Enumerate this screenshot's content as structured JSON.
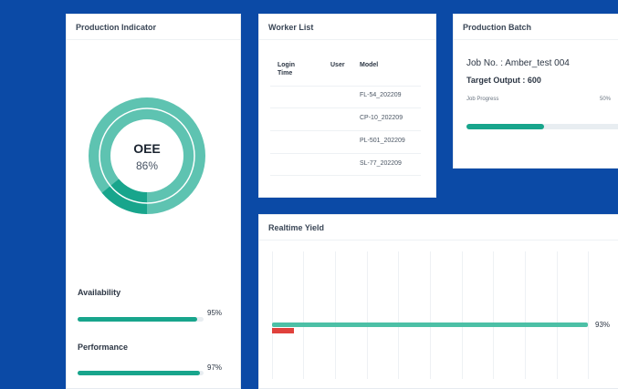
{
  "colors": {
    "background": "#0b4aa6",
    "accent": "#18a58c",
    "ring_light": "#5ec3b1",
    "alert": "#e0413c"
  },
  "indicator": {
    "title": "Production Indicator",
    "oee_label": "OEE",
    "oee_value": "86%",
    "oee_fraction": 0.86,
    "availability_label": "Availability",
    "availability_pct": "95%",
    "availability_fraction": 0.95,
    "performance_label": "Performance",
    "performance_pct": "97%",
    "performance_fraction": 0.97
  },
  "worker_list": {
    "title": "Worker List",
    "headers": [
      "Login Time",
      "User",
      "Model"
    ],
    "models": [
      "FL-54_202209",
      "CP-10_202209",
      "PL-501_202209",
      "SL-77_202209"
    ]
  },
  "batch": {
    "title": "Production Batch",
    "job_no": "Job No. : Amber_test 004",
    "target": "Target Output : 600",
    "progress_label": "Job Progress",
    "progress_pct": "50%",
    "progress_fraction": 0.5
  },
  "yield": {
    "title": "Realtime Yield",
    "value_pct": "93%",
    "value_fraction": 0.93
  }
}
